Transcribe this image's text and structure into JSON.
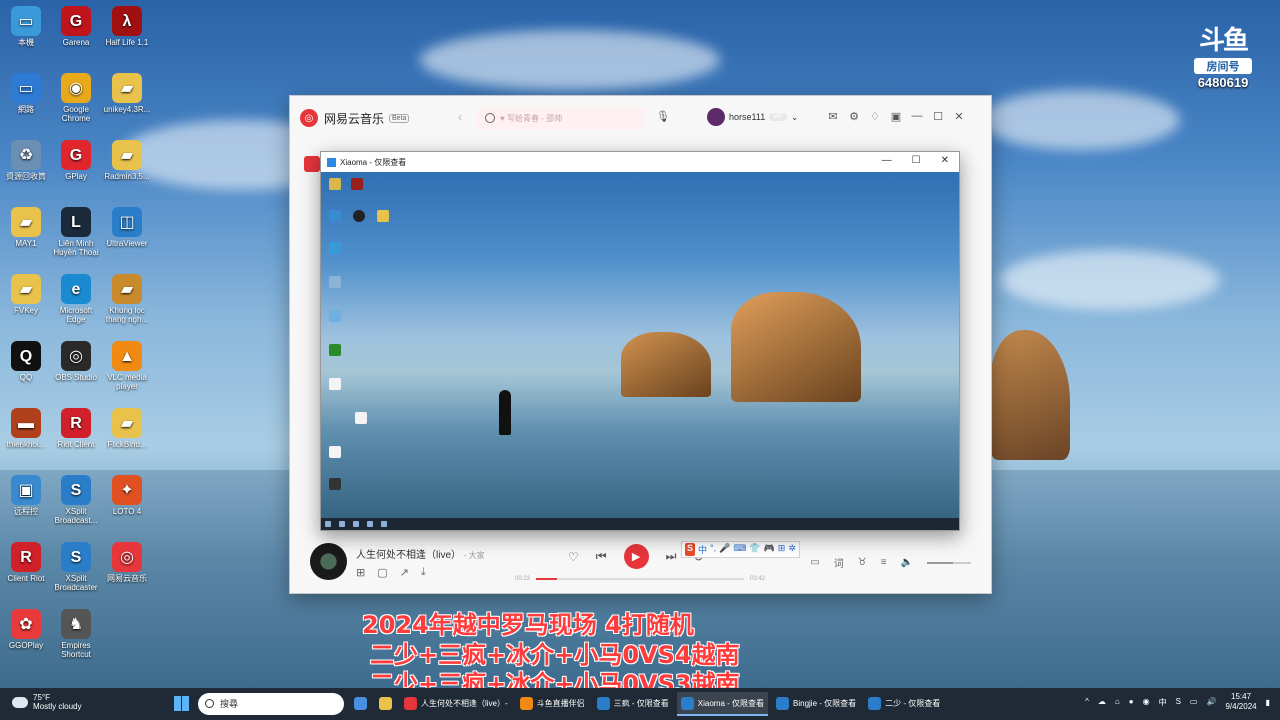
{
  "desktop": {
    "icons": [
      {
        "label": "本機",
        "color": "#3a9ad9",
        "glyph": "▭"
      },
      {
        "label": "Garena",
        "color": "#c0141c",
        "glyph": "G"
      },
      {
        "label": "Half Life 1.1",
        "color": "#a01010",
        "glyph": "λ"
      },
      {
        "label": "網路",
        "color": "#2d7bd4",
        "glyph": "▭"
      },
      {
        "label": "Google Chrome",
        "color": "#e8a91a",
        "glyph": "◉"
      },
      {
        "label": "unikey4.3R...",
        "color": "#e8c24a",
        "glyph": "▰"
      },
      {
        "label": "資源回收筒",
        "color": "#6b8eb3",
        "glyph": "♻"
      },
      {
        "label": "GPlay",
        "color": "#e1252d",
        "glyph": "G"
      },
      {
        "label": "Radmin3.5...",
        "color": "#e8c24a",
        "glyph": "▰"
      },
      {
        "label": "MAY1",
        "color": "#e8c24a",
        "glyph": "▰"
      },
      {
        "label": "Liên Minh Huyền Thoại",
        "color": "#1a2a3a",
        "glyph": "L"
      },
      {
        "label": "UltraViewer",
        "color": "#2a7ec9",
        "glyph": "◫"
      },
      {
        "label": "FVKey",
        "color": "#e8c24a",
        "glyph": "▰"
      },
      {
        "label": "Microsoft Edge",
        "color": "#1a8bd0",
        "glyph": "e"
      },
      {
        "label": "Khung lọc thang ngh...",
        "color": "#c88a2a",
        "glyph": "▰"
      },
      {
        "label": "QQ",
        "color": "#111111",
        "glyph": "Q"
      },
      {
        "label": "OBS Studio",
        "color": "#2a2a2a",
        "glyph": "◎"
      },
      {
        "label": "VLC media player",
        "color": "#f08a12",
        "glyph": "▲"
      },
      {
        "label": "thienkhoi...",
        "color": "#b0401c",
        "glyph": "▬"
      },
      {
        "label": "Riot Client",
        "color": "#d0202a",
        "glyph": "R"
      },
      {
        "label": "FlickBind...",
        "color": "#e8c24a",
        "glyph": "▰"
      },
      {
        "label": "远程控",
        "color": "#3a8ad0",
        "glyph": "▣"
      },
      {
        "label": "XSplit Broadcast...",
        "color": "#2a7ec9",
        "glyph": "S"
      },
      {
        "label": "LOTO 4",
        "color": "#e05020",
        "glyph": "✦"
      },
      {
        "label": "Client Riot",
        "color": "#d0202a",
        "glyph": "R"
      },
      {
        "label": "XSplit Broadcaster",
        "color": "#2a7ec9",
        "glyph": "S"
      },
      {
        "label": "网易云音乐",
        "color": "#e6353b",
        "glyph": "◎"
      },
      {
        "label": "GGOPlay",
        "color": "#e83a3a",
        "glyph": "✿"
      },
      {
        "label": "Empires Shortcut",
        "color": "#555555",
        "glyph": "♞"
      }
    ]
  },
  "douyu": {
    "logo": "斗鱼",
    "room_label": "房间号",
    "room_number": "6480619"
  },
  "netease": {
    "app_title": "网易云音乐",
    "beta": "Beta",
    "search_placeholder": "♥ 写给青春 - 邵帅",
    "username": "horse111",
    "vip_label": "VIP",
    "now_playing": {
      "title": "人生何处不相逢（live）",
      "artist": "- 大家",
      "elapsed": "00:23",
      "total": "03:42",
      "progress": 0.1
    },
    "ime_items": [
      "S",
      "中",
      "°,",
      "🎤",
      "⌨",
      "👕",
      "🎮",
      "⊞",
      "✲"
    ]
  },
  "xiaoma": {
    "title": "Xiaoma - 仅限查看",
    "min": "—",
    "max": "☐",
    "close": "✕"
  },
  "captions": [
    "2024年越中罗马现场 4打随机",
    "二少+三疯+冰介+小马0VS4越南",
    "二少+三疯+冰介+小马0VS3越南"
  ],
  "taskbar": {
    "weather_temp": "75°F",
    "weather_desc": "Mostly cloudy",
    "search_placeholder": "搜尋",
    "apps": [
      {
        "label": "",
        "color": "#4a90e2",
        "active": false
      },
      {
        "label": "",
        "color": "#e8c24a",
        "active": false
      },
      {
        "label": "人生何处不相逢（live）-",
        "color": "#e6353b",
        "active": false
      },
      {
        "label": "斗鱼直播伴侣",
        "color": "#f08a12",
        "active": false
      },
      {
        "label": "三疯 - 仅限查看",
        "color": "#2a7ec9",
        "active": false
      },
      {
        "label": "Xiaoma - 仅限查看",
        "color": "#2a7ec9",
        "active": true
      },
      {
        "label": "Bingjie - 仅限查看",
        "color": "#2a7ec9",
        "active": false
      },
      {
        "label": "二少 - 仅限查看",
        "color": "#2a7ec9",
        "active": false
      }
    ],
    "tray": [
      "^",
      "☁",
      "⌂",
      "●",
      "◉",
      "中",
      "S",
      "▭",
      "🔊"
    ],
    "time": "15:47",
    "date": "9/4/2024"
  }
}
